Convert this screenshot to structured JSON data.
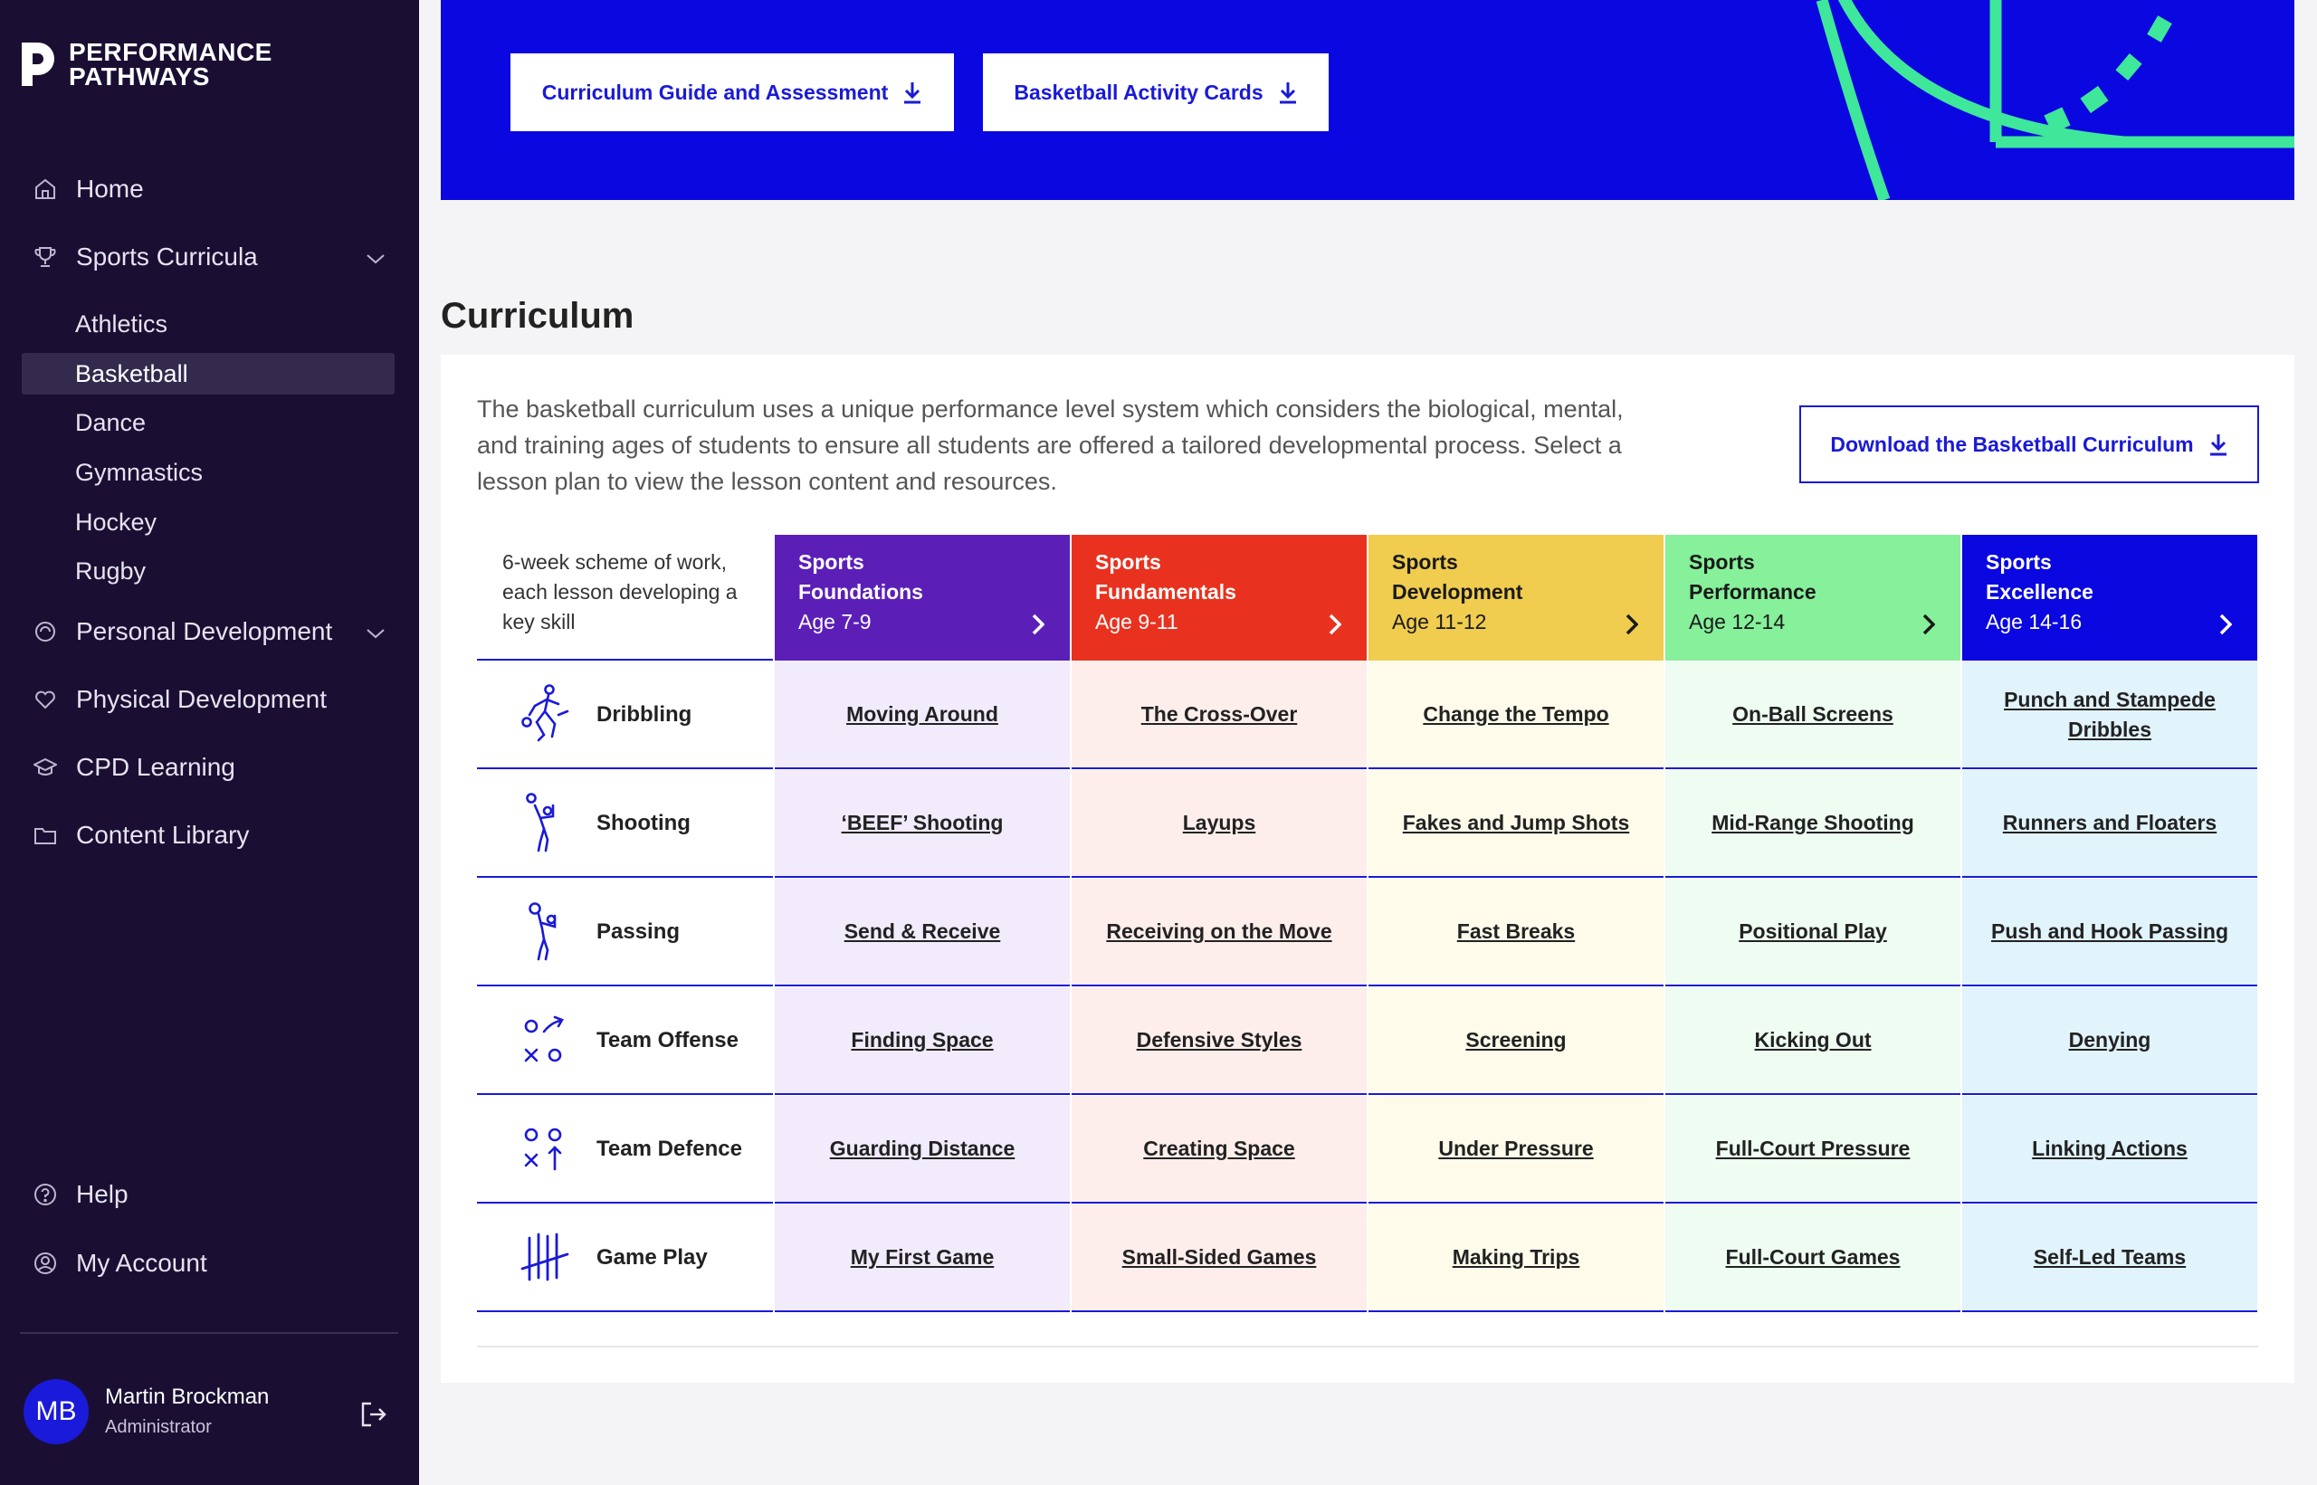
{
  "brand": {
    "line1": "PERFORMANCE",
    "line2": "PATHWAYS"
  },
  "nav": {
    "home": "Home",
    "sports_curricula": "Sports Curricula",
    "sub": [
      "Athletics",
      "Basketball",
      "Dance",
      "Gymnastics",
      "Hockey",
      "Rugby"
    ],
    "personal_development": "Personal Development",
    "physical_development": "Physical Development",
    "cpd_learning": "CPD Learning",
    "content_library": "Content Library",
    "help": "Help",
    "my_account": "My Account"
  },
  "user": {
    "initials": "MB",
    "name": "Martin Brockman",
    "role": "Administrator"
  },
  "banner": {
    "btn1": "Curriculum Guide and Assessment",
    "btn2": "Basketball Activity Cards"
  },
  "section": {
    "title": "Curriculum",
    "intro": "The basketball curriculum uses a unique performance level system which considers the biological, mental, and training ages of students to ensure all students are offered a tailored developmental process. Select a lesson plan to view the lesson content and resources.",
    "download": "Download the Basketball Curriculum"
  },
  "grid": {
    "description": "6-week scheme of work, each lesson developing a key skill",
    "levels": [
      {
        "line1": "Sports",
        "line2": "Foundations",
        "age": "Age 7-9",
        "color": "#5b1fb8",
        "text": "#ffffff",
        "cell": "#f1ebfb"
      },
      {
        "line1": "Sports",
        "line2": "Fundamentals",
        "age": "Age 9-11",
        "color": "#e8321f",
        "text": "#ffffff",
        "cell": "#fdeeeb"
      },
      {
        "line1": "Sports",
        "line2": "Development",
        "age": "Age 11-12",
        "color": "#f0cc4f",
        "text": "#1a1a1a",
        "cell": "#fefbea"
      },
      {
        "line1": "Sports",
        "line2": "Performance",
        "age": "Age 12-14",
        "color": "#86f09a",
        "text": "#1a1a1a",
        "cell": "#eefcf1"
      },
      {
        "line1": "Sports",
        "line2": "Excellence",
        "age": "Age 14-16",
        "color": "#0a07e0",
        "text": "#ffffff",
        "cell": "#e1f3fb"
      }
    ],
    "rows": [
      {
        "skill": "Dribbling",
        "icon": "dribbling-icon",
        "lessons": [
          "Moving Around",
          "The Cross-Over",
          "Change the Tempo",
          "On-Ball Screens",
          "Punch and Stampede Dribbles"
        ]
      },
      {
        "skill": "Shooting",
        "icon": "shooting-icon",
        "lessons": [
          "‘BEEF’ Shooting",
          "Layups",
          "Fakes and Jump Shots",
          "Mid-Range Shooting",
          "Runners and Floaters"
        ]
      },
      {
        "skill": "Passing",
        "icon": "passing-icon",
        "lessons": [
          "Send & Receive",
          "Receiving on the Move",
          "Fast Breaks",
          "Positional Play",
          "Push and Hook Passing"
        ]
      },
      {
        "skill": "Team Offense",
        "icon": "team-offense-icon",
        "lessons": [
          "Finding Space",
          "Defensive Styles",
          "Screening",
          "Kicking Out",
          "Denying"
        ]
      },
      {
        "skill": "Team Defence",
        "icon": "team-defence-icon",
        "lessons": [
          "Guarding Distance",
          "Creating Space",
          "Under Pressure",
          "Full-Court Pressure",
          "Linking Actions"
        ]
      },
      {
        "skill": "Game Play",
        "icon": "game-play-icon",
        "lessons": [
          "My First Game",
          "Small-Sided Games",
          "Making Trips",
          "Full-Court Games",
          "Self-Led Teams"
        ]
      }
    ]
  }
}
